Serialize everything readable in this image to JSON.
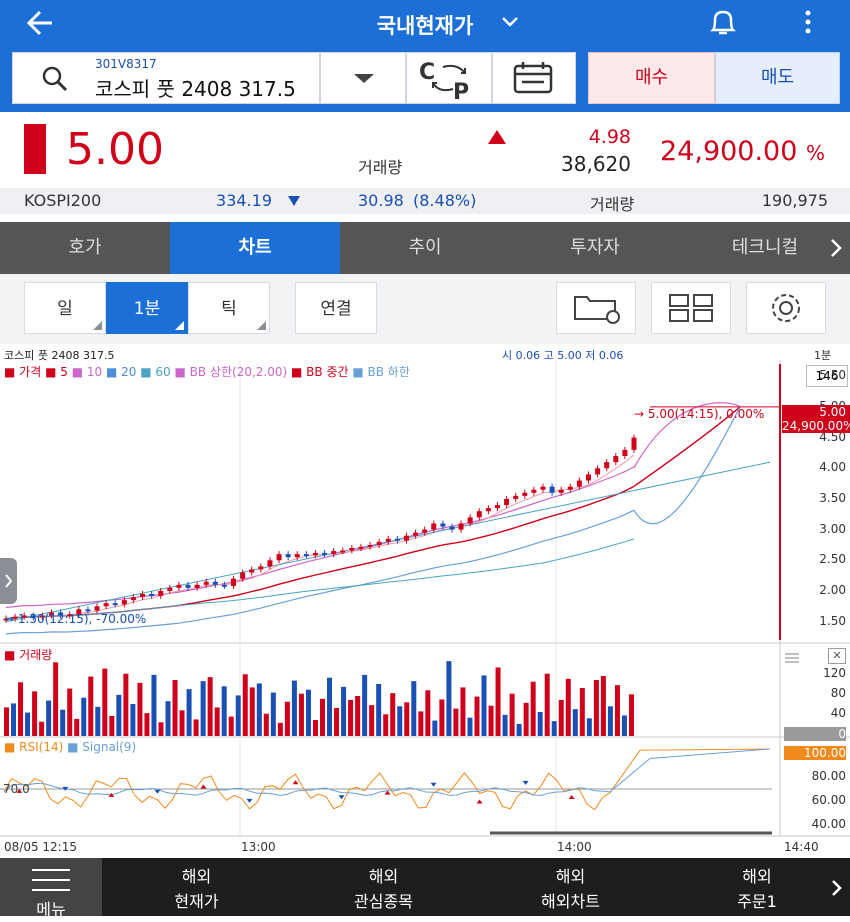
{
  "header": {
    "title": "국내현재가"
  },
  "search": {
    "code": "301V8317",
    "name": "코스피 풋 2408 317.5"
  },
  "order": {
    "buy": "매수",
    "sell": "매도"
  },
  "price": {
    "current": "5.00",
    "change": "4.98",
    "volume_label": "거래량",
    "volume": "38,620",
    "rate": "24,900.00",
    "rate_unit": "%"
  },
  "index": {
    "name": "KOSPI200",
    "value": "334.19",
    "change": "30.98",
    "rate": "(8.48%)",
    "volume_label": "거래량",
    "volume": "190,975"
  },
  "tabs": [
    "호가",
    "차트",
    "추이",
    "투자자",
    "테크니컬"
  ],
  "chart_options": {
    "day": "일",
    "minute": "1분",
    "tick": "틱",
    "link": "연결"
  },
  "chart_header": {
    "name": "코스피 풋 2408 317.5",
    "ohlc": "시 0.06  고 5.00  저 0.06",
    "period": "1분"
  },
  "legend": {
    "price": "가격",
    "ma5": "5",
    "ma10": "10",
    "ma20": "20",
    "ma60": "60",
    "bb_upper": "BB 상한(20,2.00)",
    "bb_mid": "BB 중간",
    "bb_lower": "BB 하한"
  },
  "annotations": {
    "high": "5.00(14:15), 0.00%",
    "low": "1.50(12:15), -70.00%"
  },
  "price_axis": {
    "ticks": [
      "5.50",
      "5.00",
      "4.50",
      "4.00",
      "3.50",
      "3.00",
      "2.50",
      "2.00",
      "1.50"
    ],
    "count_box": "146",
    "current_tag": "5.00",
    "rate_tag": "24,900.00%"
  },
  "volume_panel": {
    "label": "거래량",
    "ticks": [
      "120",
      "80",
      "40"
    ],
    "current_tag": "0"
  },
  "rsi_panel": {
    "label_rsi": "RSI(14)",
    "label_signal": "Signal(9)",
    "ticks": [
      "80.00",
      "60.00",
      "40.00"
    ],
    "current_tag": "100.00",
    "line_label": "70.0"
  },
  "time_axis": [
    "08/05 12:15",
    "13:00",
    "14:00",
    "14:40"
  ],
  "bottom_nav": [
    {
      "line1": "",
      "line2": "메뉴"
    },
    {
      "line1": "해외",
      "line2": "현재가"
    },
    {
      "line1": "해외",
      "line2": "관심종목"
    },
    {
      "line1": "해외",
      "line2": "해외차트"
    },
    {
      "line1": "해외",
      "line2": "주문1"
    }
  ],
  "colors": {
    "brand": "#1b6fd6",
    "up": "#d0021b",
    "down": "#1a4fb5",
    "rsi": "#f08a1c"
  },
  "chart_data": [
    {
      "type": "candlestick",
      "title": "코스피 풋 2408 317.5",
      "x_start": "08/05 12:15",
      "x_end": "14:40",
      "ylim": [
        1.2,
        5.7
      ],
      "close": [
        1.55,
        1.58,
        1.6,
        1.57,
        1.6,
        1.65,
        1.6,
        1.62,
        1.7,
        1.68,
        1.75,
        1.8,
        1.78,
        1.85,
        1.9,
        1.95,
        1.92,
        2.0,
        2.05,
        2.1,
        2.05,
        2.1,
        2.15,
        2.1,
        2.08,
        2.2,
        2.3,
        2.35,
        2.4,
        2.5,
        2.6,
        2.55,
        2.6,
        2.58,
        2.62,
        2.6,
        2.65,
        2.66,
        2.7,
        2.72,
        2.75,
        2.8,
        2.85,
        2.82,
        2.9,
        2.95,
        3.0,
        3.1,
        3.05,
        3.0,
        3.1,
        3.2,
        3.3,
        3.35,
        3.4,
        3.5,
        3.55,
        3.6,
        3.65,
        3.7,
        3.6,
        3.65,
        3.7,
        3.8,
        3.9,
        4.0,
        4.1,
        4.2,
        4.3,
        4.5
      ],
      "volume_range": [
        0,
        140
      ],
      "rsi_range": [
        30,
        100
      ]
    }
  ]
}
